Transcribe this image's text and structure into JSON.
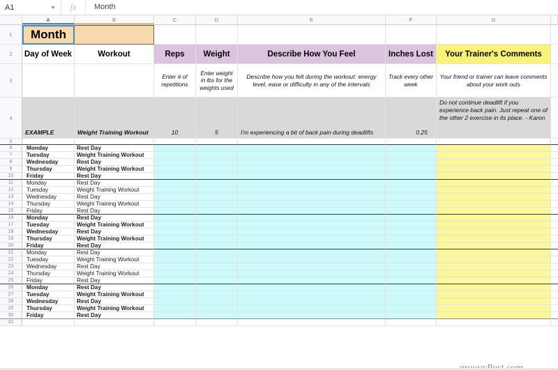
{
  "formula_bar": {
    "name_box": "A1",
    "fx_label": "fx",
    "content": "Month"
  },
  "columns": [
    "A",
    "B",
    "C",
    "D",
    "E",
    "F",
    "G"
  ],
  "sheet": {
    "row1": {
      "a": "Month",
      "b": ""
    },
    "headers": {
      "a": "Day of Week",
      "b": "Workout",
      "c": "Reps",
      "d": "Weight",
      "e": "Describe How You Feel",
      "f": "Inches Lost",
      "g": "Your Trainer's Comments"
    },
    "instructions": {
      "a": "",
      "b": "",
      "c": "Enter # of repetitions",
      "d": "Enter weight in lbs for the weights used",
      "e": "Describe how you felt during the workout: energy level, ease or difficulty in any of the intervals",
      "f": "Track every other week",
      "g": "Your friend or trainer can leave comments about your work outs"
    },
    "example": {
      "a": "EXAMPLE",
      "b": "Weight Training Workout",
      "c": "10",
      "d": "5",
      "e": "I'm experiencing a bit of back pain during deadlifts",
      "f": "0.25",
      "g": "Do not continue deadlift if you experience back pain.  Just repeat one of the other 2 exercise in its place.  - Karon"
    },
    "data_rows": [
      {
        "row": 6,
        "day": "Monday",
        "workout": "Rest Day",
        "bold": true,
        "block_end": false
      },
      {
        "row": 7,
        "day": "Tuesday",
        "workout": "Weight Training Workout",
        "bold": true,
        "block_end": false
      },
      {
        "row": 8,
        "day": "Wednesday",
        "workout": "Rest Day",
        "bold": true,
        "block_end": false
      },
      {
        "row": 9,
        "day": "Thursday",
        "workout": "Weight Training Workout",
        "bold": true,
        "block_end": false
      },
      {
        "row": 10,
        "day": "Friday",
        "workout": "Rest Day",
        "bold": true,
        "block_end": true
      },
      {
        "row": 11,
        "day": "Monday",
        "workout": "Rest Day",
        "bold": false,
        "block_end": false
      },
      {
        "row": 12,
        "day": "Tuesday",
        "workout": "Weight Training Workout",
        "bold": false,
        "block_end": false
      },
      {
        "row": 13,
        "day": "Wednesday",
        "workout": "Rest Day",
        "bold": false,
        "block_end": false
      },
      {
        "row": 14,
        "day": "Thursday",
        "workout": "Weight Training Workout",
        "bold": false,
        "block_end": false
      },
      {
        "row": 15,
        "day": "Friday",
        "workout": "Rest Day",
        "bold": false,
        "block_end": true
      },
      {
        "row": 16,
        "day": "Monday",
        "workout": "Rest Day",
        "bold": true,
        "block_end": false
      },
      {
        "row": 17,
        "day": "Tuesday",
        "workout": "Weight Training Workout",
        "bold": true,
        "block_end": false
      },
      {
        "row": 18,
        "day": "Wednesday",
        "workout": "Rest Day",
        "bold": true,
        "block_end": false
      },
      {
        "row": 19,
        "day": "Thursday",
        "workout": "Weight Training Workout",
        "bold": true,
        "block_end": false
      },
      {
        "row": 20,
        "day": "Friday",
        "workout": "Rest Day",
        "bold": true,
        "block_end": true
      },
      {
        "row": 21,
        "day": "Monday",
        "workout": "Rest Day",
        "bold": false,
        "block_end": false
      },
      {
        "row": 22,
        "day": "Tuesday",
        "workout": "Weight Training Workout",
        "bold": false,
        "block_end": false
      },
      {
        "row": 23,
        "day": "Wednesday",
        "workout": "Rest Day",
        "bold": false,
        "block_end": false
      },
      {
        "row": 24,
        "day": "Thursday",
        "workout": "Weight Training Workout",
        "bold": false,
        "block_end": false
      },
      {
        "row": 25,
        "day": "Friday",
        "workout": "Rest Day",
        "bold": false,
        "block_end": true
      },
      {
        "row": 26,
        "day": "Monday",
        "workout": "Rest Day",
        "bold": true,
        "block_end": false
      },
      {
        "row": 27,
        "day": "Tuesday",
        "workout": "Weight Training Workout",
        "bold": true,
        "block_end": false
      },
      {
        "row": 28,
        "day": "Wednesday",
        "workout": "Rest Day",
        "bold": true,
        "block_end": false
      },
      {
        "row": 29,
        "day": "Thursday",
        "workout": "Weight Training Workout",
        "bold": true,
        "block_end": false
      },
      {
        "row": 30,
        "day": "Friday",
        "workout": "Rest Day",
        "bold": true,
        "block_end": true
      }
    ],
    "row_numbers": {
      "r1": "1",
      "r2": "2",
      "r3": "3",
      "r4": "4",
      "r5": "5",
      "r31": "31"
    }
  },
  "watermark": "groovyPost.com",
  "colors": {
    "month_fill": "#f8d9ae",
    "header_purple": "#dcc4e0",
    "header_yellow": "#faf377",
    "example_gray": "#d9d9d9",
    "entry_cyan": "#ccfbfb",
    "entry_yellow": "#fbf79a",
    "selection_blue": "#4a86c8"
  }
}
